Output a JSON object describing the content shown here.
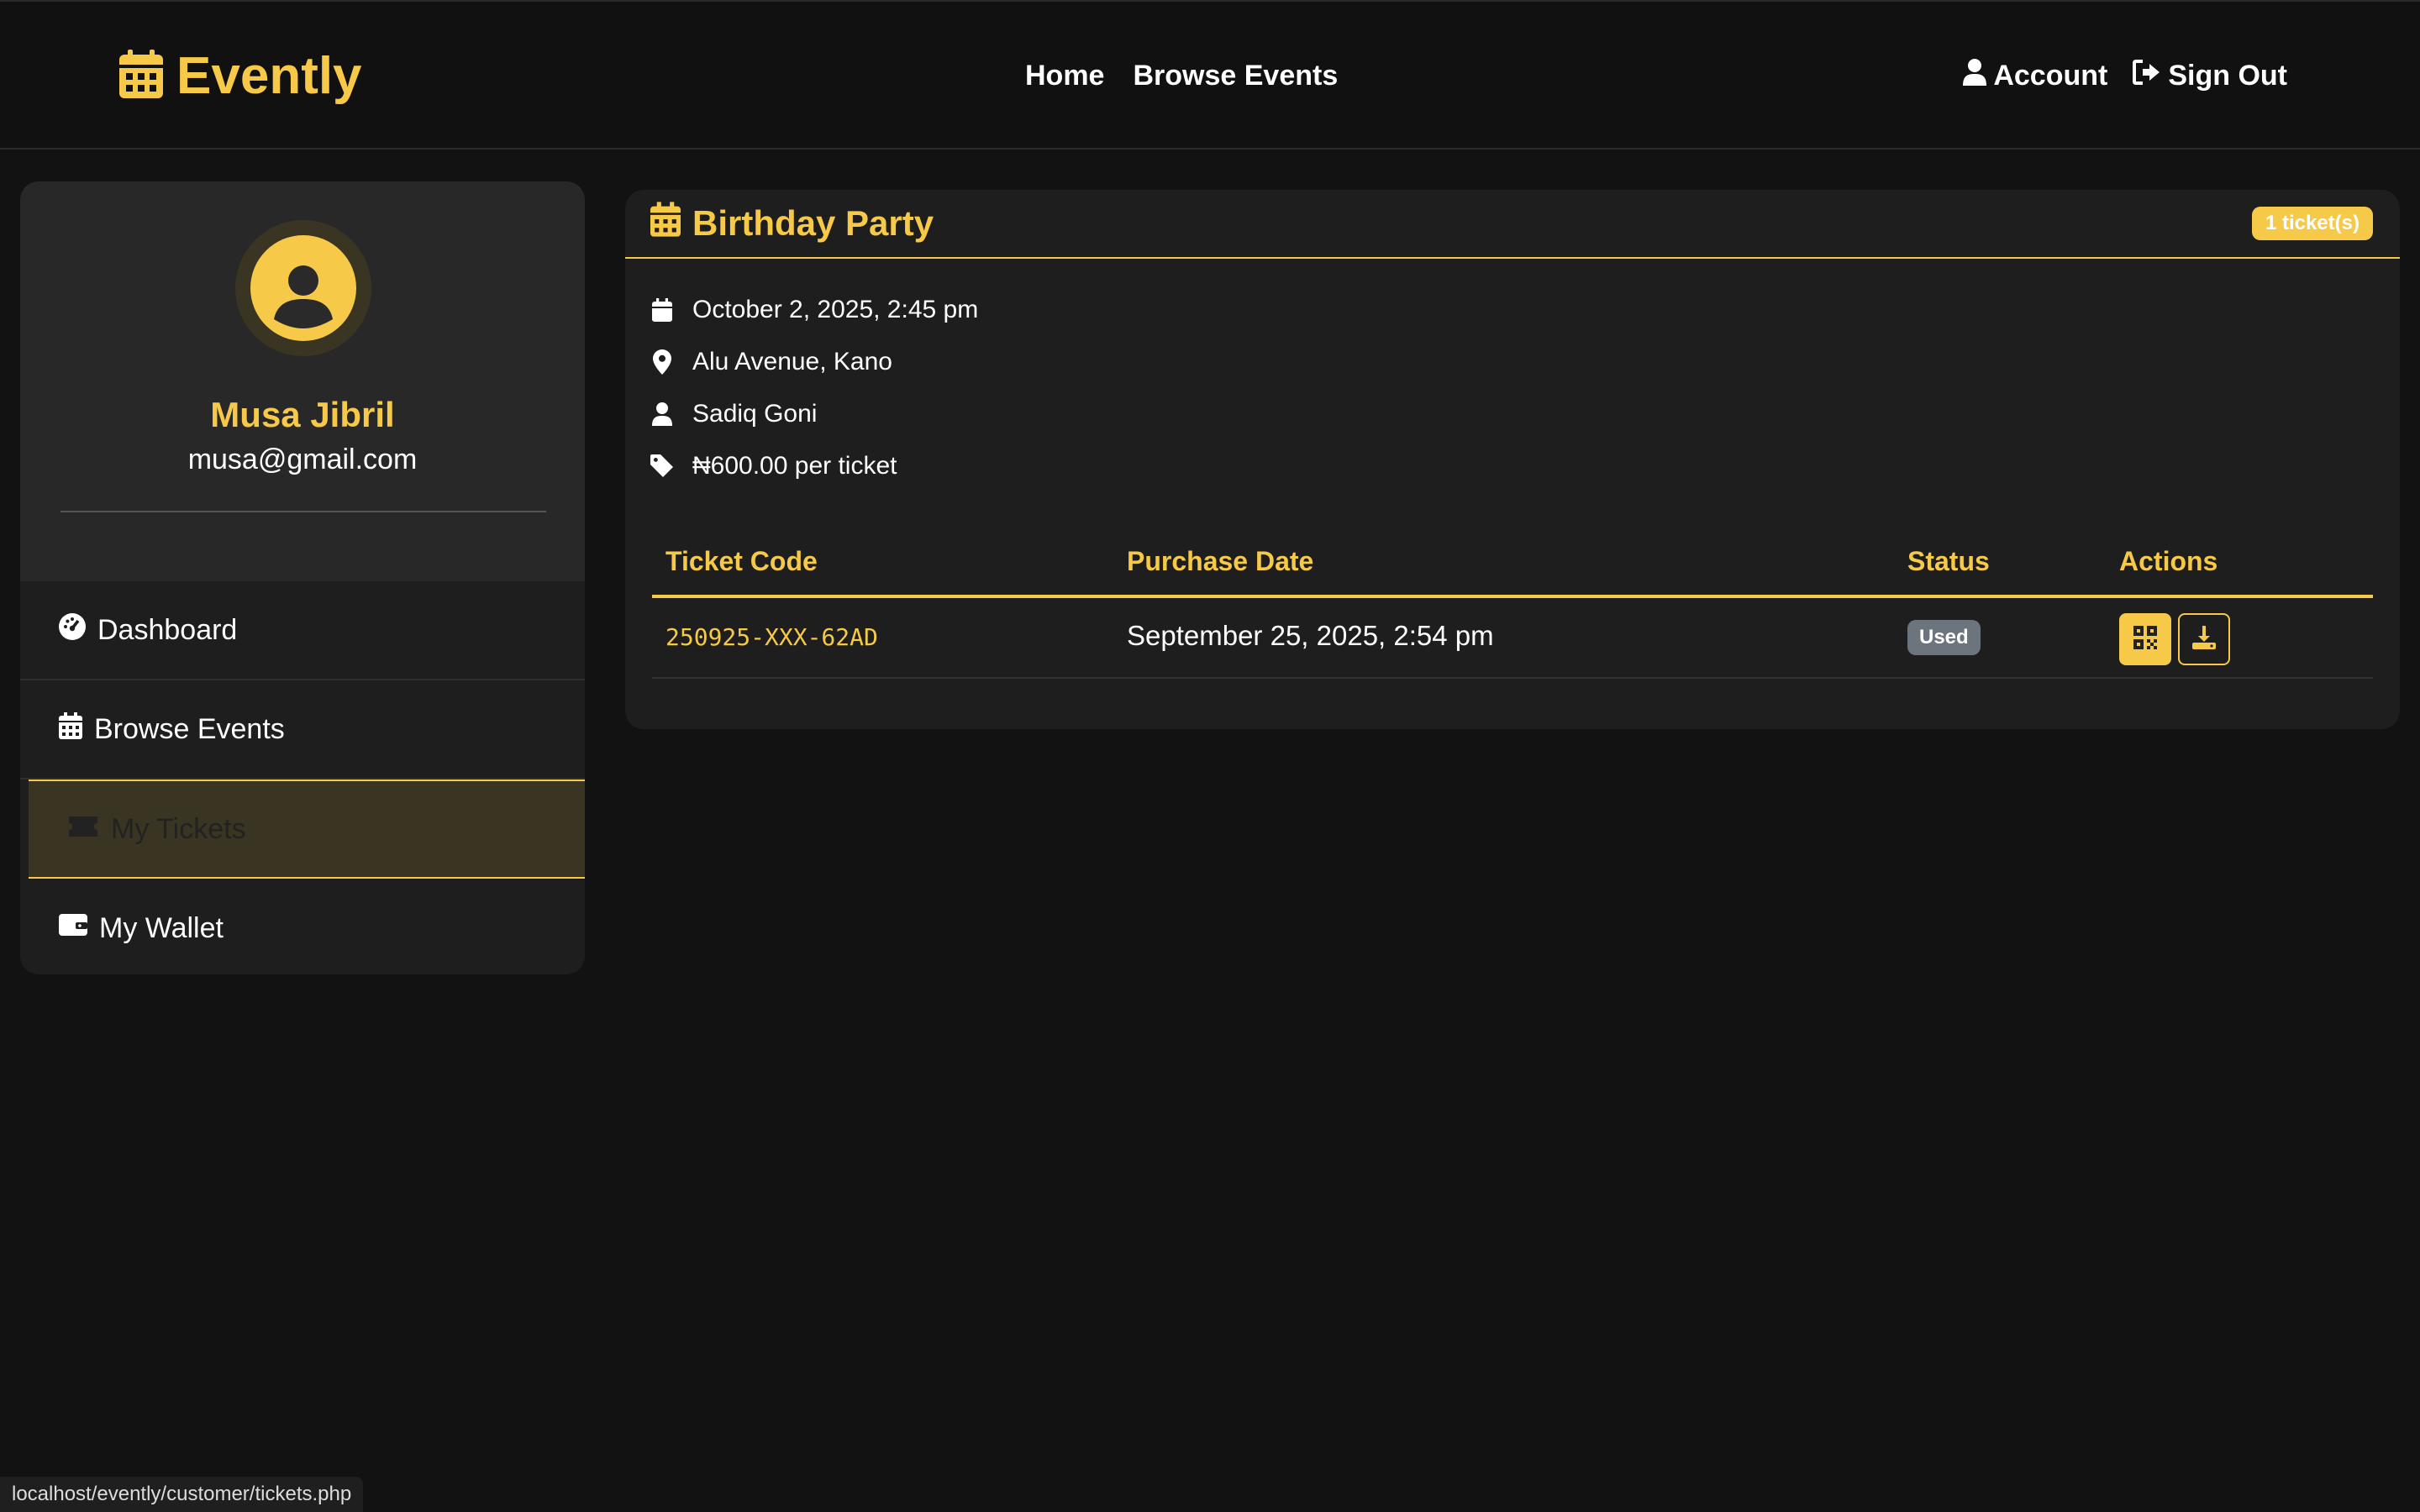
{
  "navbar": {
    "brand": "Evently",
    "links": [
      "Home",
      "Browse Events"
    ],
    "account": "Account",
    "sign_out": "Sign Out"
  },
  "sidebar": {
    "user_name": "Musa Jibril",
    "user_email": "musa@gmail.com",
    "items": [
      {
        "label": "Dashboard",
        "icon": "dashboard-icon"
      },
      {
        "label": "Browse Events",
        "icon": "calendar-icon"
      },
      {
        "label": "My Tickets",
        "icon": "ticket-icon",
        "active": true
      },
      {
        "label": "My Wallet",
        "icon": "wallet-icon"
      }
    ]
  },
  "event": {
    "title": "Birthday Party",
    "ticket_count": "1 ticket(s)",
    "date": "October 2, 2025, 2:45 pm",
    "location": "Alu Avenue, Kano",
    "organizer": "Sadiq Goni",
    "price": "₦600.00 per ticket"
  },
  "tickets_table": {
    "headers": [
      "Ticket Code",
      "Purchase Date",
      "Status",
      "Actions"
    ],
    "rows": [
      {
        "code": "250925-XXX-62AD",
        "purchase_date": "September 25, 2025, 2:54 pm",
        "status": "Used"
      }
    ]
  },
  "status_url": "localhost/evently/customer/tickets.php",
  "colors": {
    "accent": "#f7c948",
    "background": "#121212",
    "card": "#1e1e1e",
    "status_used": "#6c757d"
  }
}
